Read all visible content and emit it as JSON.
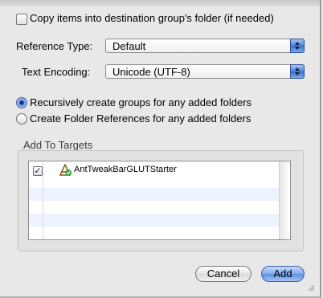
{
  "options": {
    "copy_items_label": "Copy items into destination group's folder (if needed)",
    "copy_items_checked": false
  },
  "reference_type": {
    "label": "Reference Type:",
    "value": "Default"
  },
  "text_encoding": {
    "label": "Text Encoding:",
    "value": "Unicode (UTF-8)"
  },
  "folders": {
    "recursive_label": "Recursively create groups for any added folders",
    "references_label": "Create Folder References for any added folders",
    "selected": "recursive"
  },
  "targets": {
    "label": "Add To Targets",
    "items": [
      {
        "name": "AntTweakBarGLUTStarter",
        "checked": true
      }
    ]
  },
  "buttons": {
    "cancel": "Cancel",
    "add": "Add"
  },
  "icons": [
    "application-target-icon",
    "popup-arrows-icon",
    "checkmark-icon",
    "resize-grip-icon"
  ],
  "colors": {
    "accent": "#5d8fe0",
    "row_stripe": "#edf3fe"
  }
}
